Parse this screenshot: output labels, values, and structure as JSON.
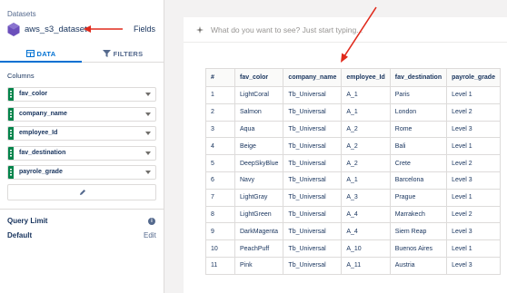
{
  "sidebar": {
    "datasets_label": "Datasets",
    "dataset_name": "aws_s3_dataset",
    "fields_link": "Fields",
    "tabs": [
      {
        "label": "DATA",
        "active": true
      },
      {
        "label": "FILTERS",
        "active": false
      }
    ],
    "columns_label": "Columns",
    "columns": [
      "fav_color",
      "company_name",
      "employee_Id",
      "fav_destination",
      "payrole_grade"
    ],
    "query_limit_label": "Query Limit",
    "query_limit_info": "i",
    "default_label": "Default",
    "edit_label": "Edit"
  },
  "main": {
    "search_placeholder": "What do you want to see? Just start typing...",
    "table": {
      "headers": [
        "#",
        "fav_color",
        "company_name",
        "employee_Id",
        "fav_destination",
        "payrole_grade"
      ],
      "rows": [
        [
          "1",
          "LightCoral",
          "Tb_Universal",
          "A_1",
          "Paris",
          "Level 1"
        ],
        [
          "2",
          "Salmon",
          "Tb_Universal",
          "A_1",
          "London",
          "Level 2"
        ],
        [
          "3",
          "Aqua",
          "Tb_Universal",
          "A_2",
          "Rome",
          "Level 3"
        ],
        [
          "4",
          "Beige",
          "Tb_Universal",
          "A_2",
          "Bali",
          "Level 1"
        ],
        [
          "5",
          "DeepSkyBlue",
          "Tb_Universal",
          "A_2",
          "Crete",
          "Level 2"
        ],
        [
          "6",
          "Navy",
          "Tb_Universal",
          "A_1",
          "Barcelona",
          "Level 3"
        ],
        [
          "7",
          "LightGray",
          "Tb_Universal",
          "A_3",
          "Prague",
          "Level 1"
        ],
        [
          "8",
          "LightGreen",
          "Tb_Universal",
          "A_4",
          "Marrakech",
          "Level 2"
        ],
        [
          "9",
          "DarkMagenta",
          "Tb_Universal",
          "A_4",
          "Siem Reap",
          "Level 3"
        ],
        [
          "10",
          "PeachPuff",
          "Tb_Universal",
          "A_10",
          "Buenos Aires",
          "Level 1"
        ],
        [
          "11",
          "Pink",
          "Tb_Universal",
          "A_11",
          "Austria",
          "Level 3"
        ]
      ]
    }
  },
  "colors": {
    "accent": "#0070d2",
    "column_grip": "#04844b",
    "dataset_icon": "#6b4fbb",
    "annotation_arrow": "#e02a1c"
  },
  "icons": {
    "dataset": "dataset-hex-icon",
    "filter": "filter-icon",
    "data_tab": "table-icon",
    "pencil": "pencil-icon",
    "info": "info-icon",
    "search": "sparkle-icon"
  }
}
